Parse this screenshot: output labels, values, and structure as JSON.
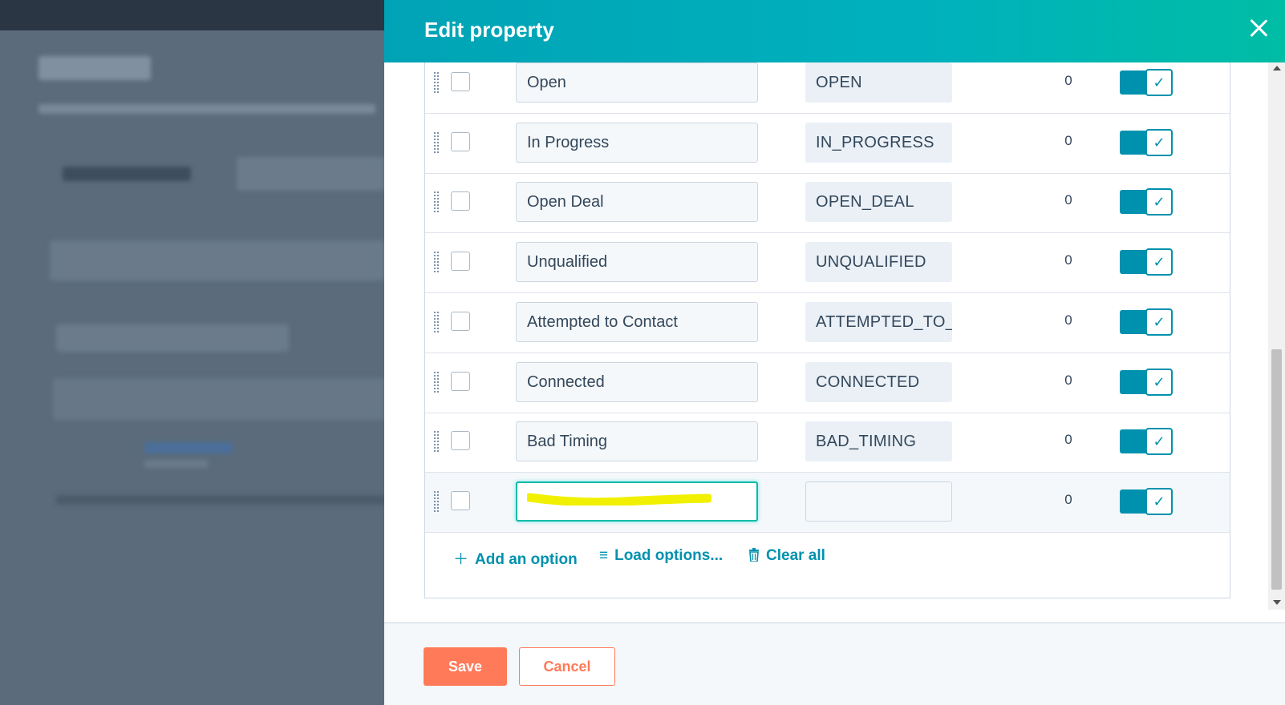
{
  "panel": {
    "title": "Edit property",
    "close_icon": "close-icon"
  },
  "options": [
    {
      "label": "Open",
      "value": "OPEN",
      "count": "0",
      "visible": true
    },
    {
      "label": "In Progress",
      "value": "IN_PROGRESS",
      "count": "0",
      "visible": true
    },
    {
      "label": "Open Deal",
      "value": "OPEN_DEAL",
      "count": "0",
      "visible": true
    },
    {
      "label": "Unqualified",
      "value": "UNQUALIFIED",
      "count": "0",
      "visible": true
    },
    {
      "label": "Attempted to Contact",
      "value": "ATTEMPTED_TO_",
      "count": "0",
      "visible": true
    },
    {
      "label": "Connected",
      "value": "CONNECTED",
      "count": "0",
      "visible": true
    },
    {
      "label": "Bad Timing",
      "value": "BAD_TIMING",
      "count": "0",
      "visible": true
    },
    {
      "label": "",
      "value": "",
      "count": "0",
      "visible": true,
      "redacted": true
    }
  ],
  "actions": {
    "add_option": "Add an option",
    "load_options": "Load options...",
    "clear_all": "Clear all"
  },
  "footer": {
    "save_label": "Save",
    "cancel_label": "Cancel"
  },
  "colors": {
    "accent": "#0091ae",
    "header_start": "#00a3b5",
    "header_end": "#00bda5",
    "save": "#ff7a59",
    "highlight": "#f0f000"
  }
}
